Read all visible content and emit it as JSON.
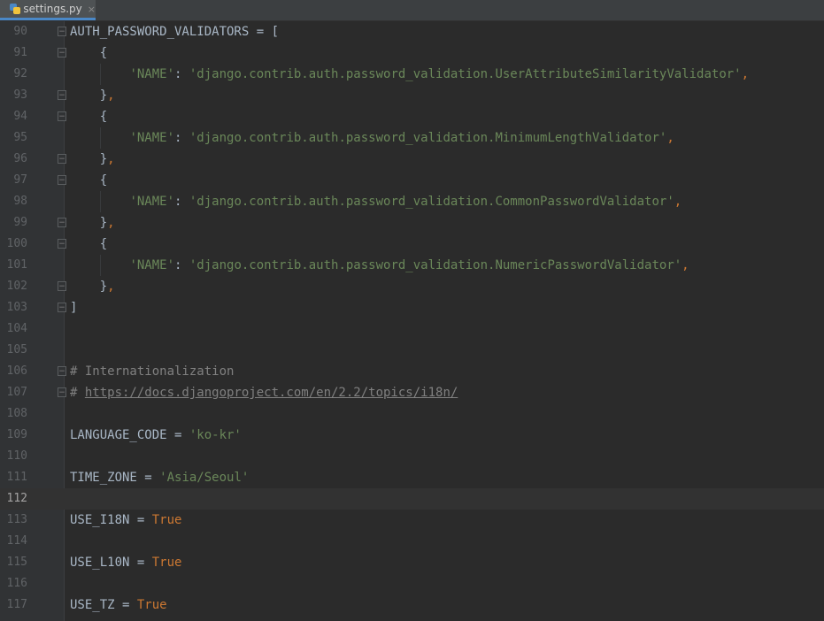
{
  "tab": {
    "filename": "settings.py",
    "close": "×"
  },
  "lines": [
    {
      "n": "90",
      "parts": [
        [
          "AUTH_PASSWORD_VALIDATORS = [",
          ""
        ]
      ]
    },
    {
      "n": "91",
      "parts": [
        [
          "    {",
          ""
        ]
      ]
    },
    {
      "n": "92",
      "parts": [
        [
          "        ",
          ""
        ],
        [
          "'NAME'",
          "str"
        ],
        [
          ": ",
          ""
        ],
        [
          "'django.contrib.auth.password_validation.UserAttributeSimilarityValidator'",
          "str"
        ],
        [
          ",",
          "kw"
        ]
      ]
    },
    {
      "n": "93",
      "parts": [
        [
          "    }",
          ""
        ],
        [
          ",",
          "kw"
        ]
      ]
    },
    {
      "n": "94",
      "parts": [
        [
          "    {",
          ""
        ]
      ]
    },
    {
      "n": "95",
      "parts": [
        [
          "        ",
          ""
        ],
        [
          "'NAME'",
          "str"
        ],
        [
          ": ",
          ""
        ],
        [
          "'django.contrib.auth.password_validation.MinimumLengthValidator'",
          "str"
        ],
        [
          ",",
          "kw"
        ]
      ]
    },
    {
      "n": "96",
      "parts": [
        [
          "    }",
          ""
        ],
        [
          ",",
          "kw"
        ]
      ]
    },
    {
      "n": "97",
      "parts": [
        [
          "    {",
          ""
        ]
      ]
    },
    {
      "n": "98",
      "parts": [
        [
          "        ",
          ""
        ],
        [
          "'NAME'",
          "str"
        ],
        [
          ": ",
          ""
        ],
        [
          "'django.contrib.auth.password_validation.CommonPasswordValidator'",
          "str"
        ],
        [
          ",",
          "kw"
        ]
      ]
    },
    {
      "n": "99",
      "parts": [
        [
          "    }",
          ""
        ],
        [
          ",",
          "kw"
        ]
      ]
    },
    {
      "n": "100",
      "parts": [
        [
          "    {",
          ""
        ]
      ]
    },
    {
      "n": "101",
      "parts": [
        [
          "        ",
          ""
        ],
        [
          "'NAME'",
          "str"
        ],
        [
          ": ",
          ""
        ],
        [
          "'django.contrib.auth.password_validation.NumericPasswordValidator'",
          "str"
        ],
        [
          ",",
          "kw"
        ]
      ]
    },
    {
      "n": "102",
      "parts": [
        [
          "    }",
          ""
        ],
        [
          ",",
          "kw"
        ]
      ]
    },
    {
      "n": "103",
      "parts": [
        [
          "]",
          ""
        ]
      ]
    },
    {
      "n": "104",
      "parts": []
    },
    {
      "n": "105",
      "parts": []
    },
    {
      "n": "106",
      "parts": [
        [
          "# Internationalization",
          "cm"
        ]
      ]
    },
    {
      "n": "107",
      "parts": [
        [
          "# ",
          "cm"
        ],
        [
          "https://docs.djangoproject.com/en/2.2/topics/i18n/",
          "link"
        ]
      ]
    },
    {
      "n": "108",
      "parts": []
    },
    {
      "n": "109",
      "parts": [
        [
          "LANGUAGE_CODE = ",
          ""
        ],
        [
          "'ko-kr'",
          "str"
        ]
      ]
    },
    {
      "n": "110",
      "parts": []
    },
    {
      "n": "111",
      "parts": [
        [
          "TIME_ZONE = ",
          ""
        ],
        [
          "'Asia/Seoul'",
          "str"
        ]
      ]
    },
    {
      "n": "112",
      "parts": [],
      "current": true
    },
    {
      "n": "113",
      "parts": [
        [
          "USE_I18N = ",
          ""
        ],
        [
          "True",
          "kw"
        ]
      ]
    },
    {
      "n": "114",
      "parts": []
    },
    {
      "n": "115",
      "parts": [
        [
          "USE_L10N = ",
          ""
        ],
        [
          "True",
          "kw"
        ]
      ]
    },
    {
      "n": "116",
      "parts": []
    },
    {
      "n": "117",
      "parts": [
        [
          "USE_TZ = ",
          ""
        ],
        [
          "True",
          "kw"
        ]
      ]
    }
  ],
  "folds": {
    "90": "open",
    "91": "open",
    "93": "close",
    "94": "open",
    "96": "close",
    "97": "open",
    "99": "close",
    "100": "open",
    "102": "close",
    "103": "close",
    "106": "open",
    "107": "close"
  },
  "colors": {
    "background": "#2b2b2b",
    "gutter": "#313335",
    "text": "#a9b7c6",
    "string": "#6a8759",
    "keyword": "#cc7832",
    "comment": "#808080",
    "line_number": "#606366"
  }
}
